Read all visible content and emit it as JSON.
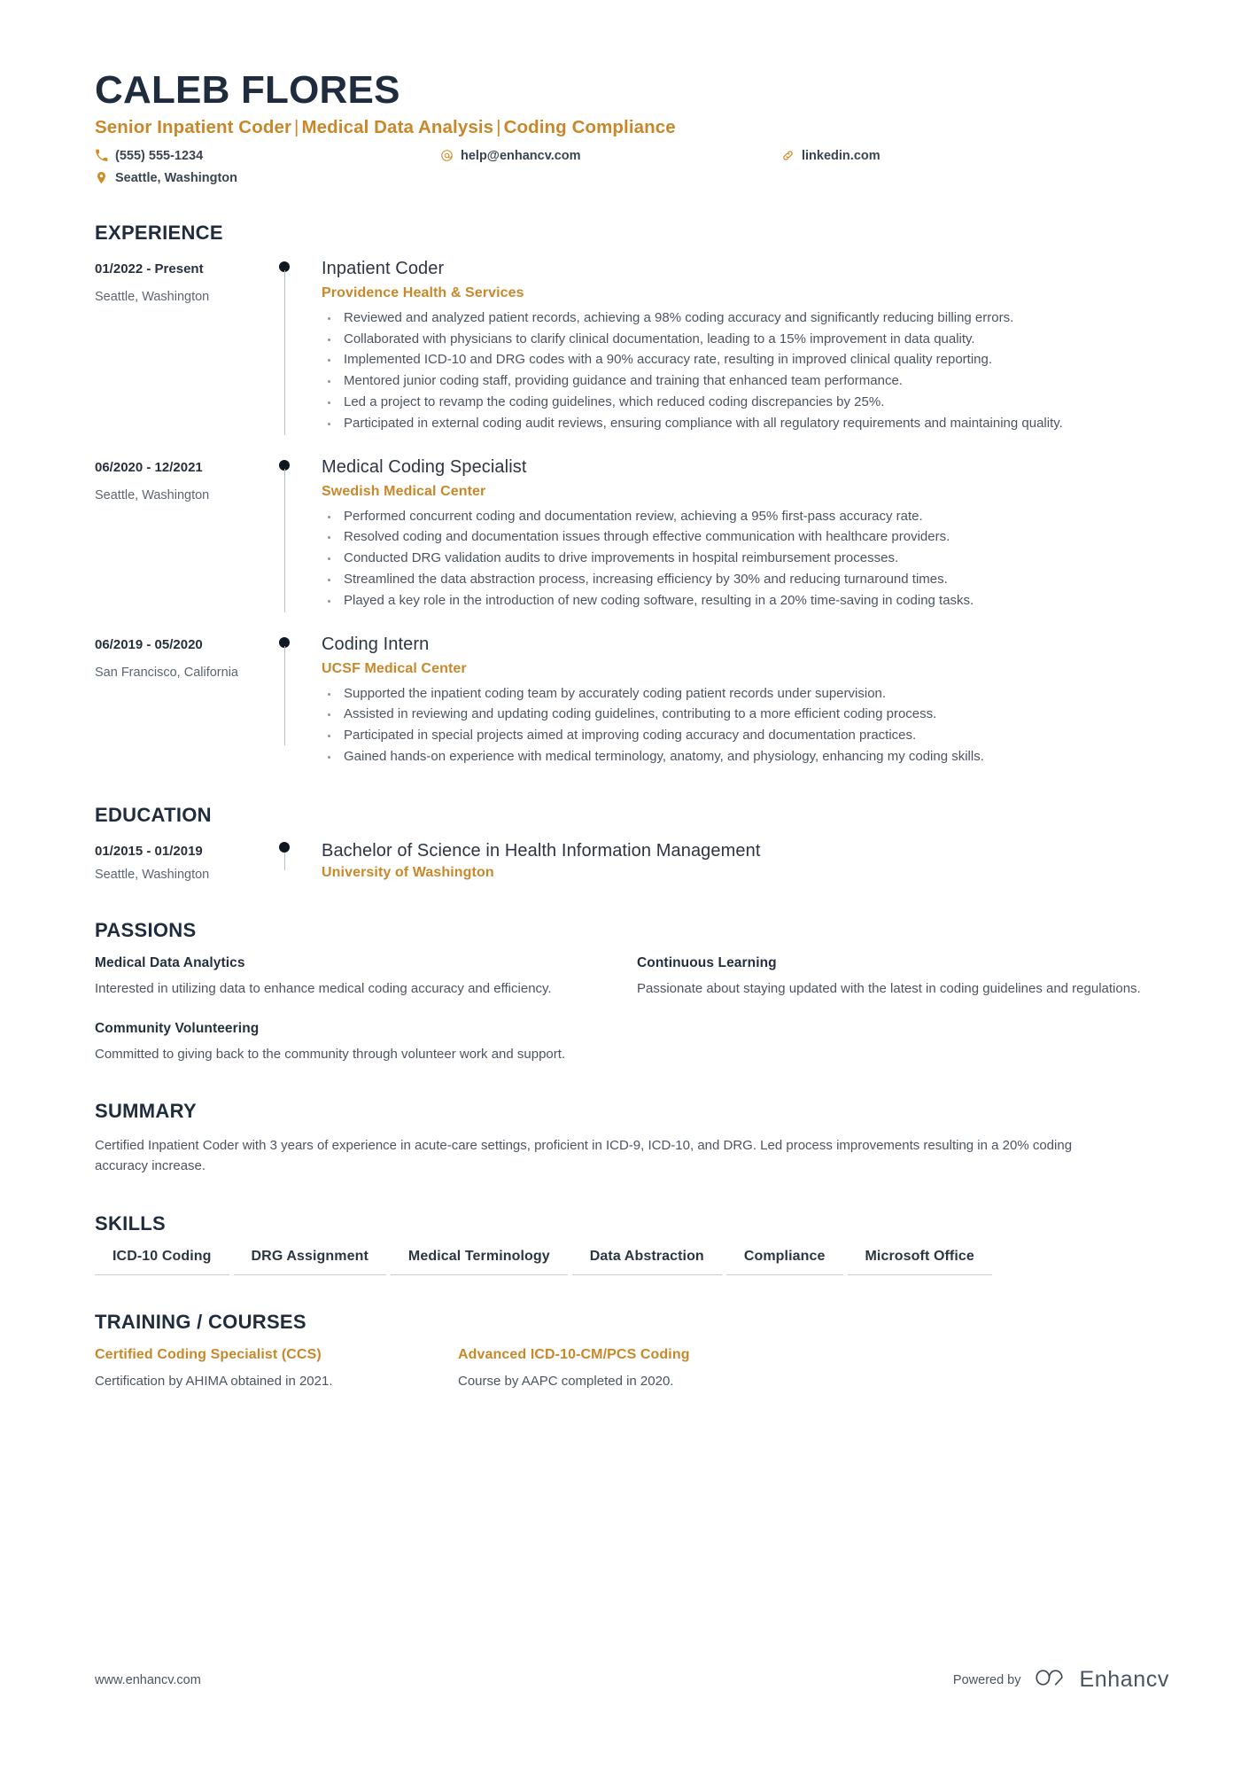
{
  "header": {
    "name": "CALEB FLORES",
    "headline_parts": [
      "Senior Inpatient Coder",
      "Medical Data Analysis",
      "Coding Compliance"
    ],
    "headline": "Senior Inpatient Coder | Medical Data Analysis | Coding Compliance",
    "contacts": [
      {
        "icon": "phone-icon",
        "text": "(555) 555-1234"
      },
      {
        "icon": "email-icon",
        "text": "help@enhancv.com"
      },
      {
        "icon": "link-icon",
        "text": "linkedin.com"
      },
      {
        "icon": "location-pin-icon",
        "text": "Seattle, Washington"
      }
    ]
  },
  "colors": {
    "accent": "#c8882a",
    "heading": "#1f2c3d",
    "body": "#4a5561",
    "rule": "#c9cdd2"
  },
  "sections": {
    "experience": {
      "title": "EXPERIENCE",
      "entries": [
        {
          "period": "01/2022 - Present",
          "location": "Seattle, Washington",
          "role": "Inpatient Coder",
          "organization": "Providence Health & Services",
          "bullets": [
            "Reviewed and analyzed patient records, achieving a 98% coding accuracy and significantly reducing billing errors.",
            "Collaborated with physicians to clarify clinical documentation, leading to a 15% improvement in data quality.",
            "Implemented ICD-10 and DRG codes with a 90% accuracy rate, resulting in improved clinical quality reporting.",
            "Mentored junior coding staff, providing guidance and training that enhanced team performance.",
            "Led a project to revamp the coding guidelines, which reduced coding discrepancies by 25%.",
            "Participated in external coding audit reviews, ensuring compliance with all regulatory requirements and maintaining quality."
          ]
        },
        {
          "period": "06/2020 - 12/2021",
          "location": "Seattle, Washington",
          "role": "Medical Coding Specialist",
          "organization": "Swedish Medical Center",
          "bullets": [
            "Performed concurrent coding and documentation review, achieving a 95% first-pass accuracy rate.",
            "Resolved coding and documentation issues through effective communication with healthcare providers.",
            "Conducted DRG validation audits to drive improvements in hospital reimbursement processes.",
            "Streamlined the data abstraction process, increasing efficiency by 30% and reducing turnaround times.",
            "Played a key role in the introduction of new coding software, resulting in a 20% time-saving in coding tasks."
          ]
        },
        {
          "period": "06/2019 - 05/2020",
          "location": "San Francisco, California",
          "role": "Coding Intern",
          "organization": "UCSF Medical Center",
          "bullets": [
            "Supported the inpatient coding team by accurately coding patient records under supervision.",
            "Assisted in reviewing and updating coding guidelines, contributing to a more efficient coding process.",
            "Participated in special projects aimed at improving coding accuracy and documentation practices.",
            "Gained hands-on experience with medical terminology, anatomy, and physiology, enhancing my coding skills."
          ]
        }
      ]
    },
    "education": {
      "title": "EDUCATION",
      "entries": [
        {
          "period": "01/2015 - 01/2019",
          "location": "Seattle, Washington",
          "degree": "Bachelor of Science in Health Information Management",
          "school": "University of Washington"
        }
      ]
    },
    "passions": {
      "title": "PASSIONS",
      "items": [
        {
          "title": "Medical Data Analytics",
          "description": "Interested in utilizing data to enhance medical coding accuracy and efficiency."
        },
        {
          "title": "Continuous Learning",
          "description": "Passionate about staying updated with the latest in coding guidelines and regulations."
        },
        {
          "title": "Community Volunteering",
          "description": "Committed to giving back to the community through volunteer work and support."
        }
      ]
    },
    "summary": {
      "title": "SUMMARY",
      "text": "Certified Inpatient Coder with 3 years of experience in acute-care settings, proficient in ICD-9, ICD-10, and DRG. Led process improvements resulting in a 20% coding accuracy increase."
    },
    "skills": {
      "title": "SKILLS",
      "items": [
        "ICD-10 Coding",
        "DRG Assignment",
        "Medical Terminology",
        "Data Abstraction",
        "Compliance",
        "Microsoft Office"
      ]
    },
    "training": {
      "title": "TRAINING / COURSES",
      "items": [
        {
          "title": "Certified Coding Specialist (CCS)",
          "description": "Certification by AHIMA obtained in 2021."
        },
        {
          "title": "Advanced ICD-10-CM/PCS Coding",
          "description": "Course by AAPC completed in 2020."
        }
      ]
    }
  },
  "footer": {
    "website": "www.enhancv.com",
    "powered_by": "Powered by",
    "brand": "Enhancv"
  }
}
